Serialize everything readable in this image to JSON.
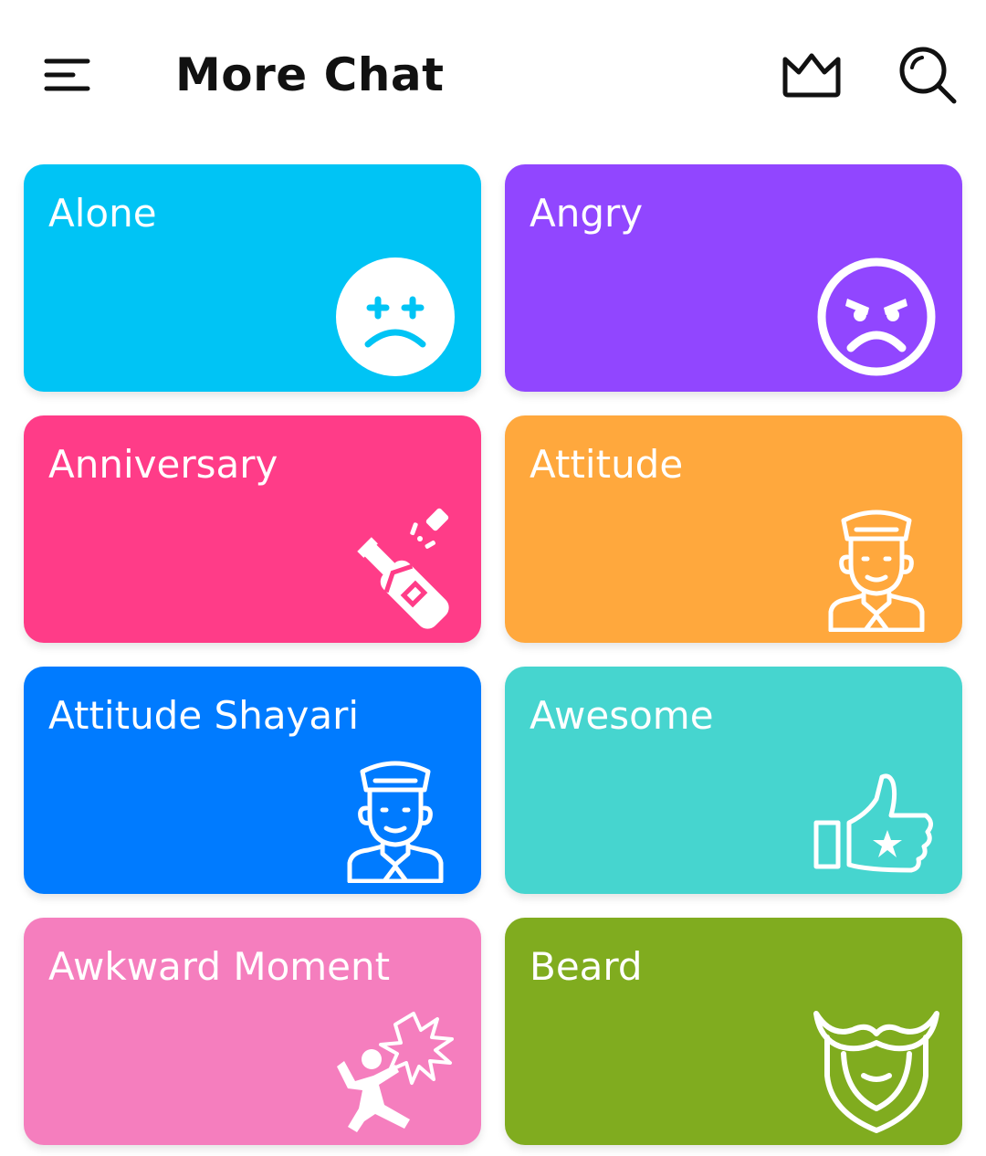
{
  "app": {
    "title": "More Chat"
  },
  "header": {
    "menu_icon": "menu-icon",
    "crown_icon": "crown-icon",
    "search_icon": "search-icon"
  },
  "categories": [
    {
      "label": "Alone",
      "color": "#00C4F5",
      "icon": "sad-face-icon"
    },
    {
      "label": "Angry",
      "color": "#9146FF",
      "icon": "angry-face-icon"
    },
    {
      "label": "Anniversary",
      "color": "#FF3C88",
      "icon": "champagne-bottle-icon"
    },
    {
      "label": "Attitude",
      "color": "#FFA83D",
      "icon": "man-with-cap-icon"
    },
    {
      "label": "Attitude Shayari",
      "color": "#007BFF",
      "icon": "man-with-cap-icon"
    },
    {
      "label": "Awesome",
      "color": "#46D5CF",
      "icon": "thumbs-up-star-icon"
    },
    {
      "label": "Awkward Moment",
      "color": "#F57EBE",
      "icon": "slipping-person-icon"
    },
    {
      "label": "Beard",
      "color": "#80AC1F",
      "icon": "beard-mustache-icon"
    }
  ]
}
